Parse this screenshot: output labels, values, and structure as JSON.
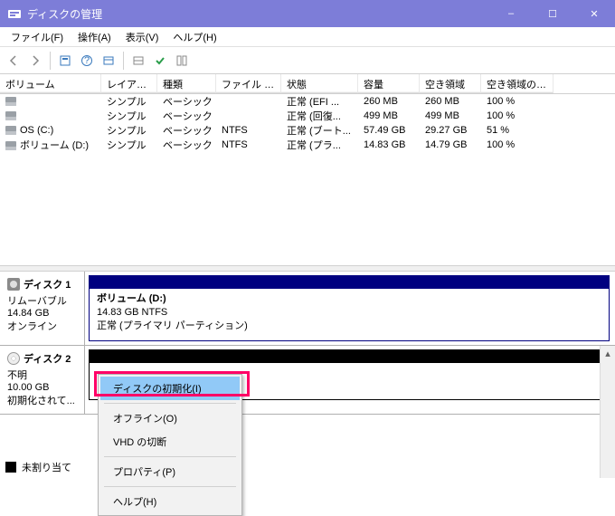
{
  "window": {
    "title": "ディスクの管理",
    "buttons": {
      "min": "–",
      "max": "☐",
      "close": "✕"
    }
  },
  "menubar": [
    "ファイル(F)",
    "操作(A)",
    "表示(V)",
    "ヘルプ(H)"
  ],
  "columns": {
    "volume": "ボリューム",
    "layout": "レイアウト",
    "type": "種類",
    "fs": "ファイル システム",
    "status": "状態",
    "capacity": "容量",
    "free": "空き領域",
    "pct": "空き領域の割..."
  },
  "volumes": [
    {
      "name": "",
      "layout": "シンプル",
      "type": "ベーシック",
      "fs": "",
      "status": "正常 (EFI ...",
      "capacity": "260 MB",
      "free": "260 MB",
      "pct": "100 %"
    },
    {
      "name": "",
      "layout": "シンプル",
      "type": "ベーシック",
      "fs": "",
      "status": "正常 (回復...",
      "capacity": "499 MB",
      "free": "499 MB",
      "pct": "100 %"
    },
    {
      "name": "OS (C:)",
      "layout": "シンプル",
      "type": "ベーシック",
      "fs": "NTFS",
      "status": "正常 (ブート...",
      "capacity": "57.49 GB",
      "free": "29.27 GB",
      "pct": "51 %"
    },
    {
      "name": "ボリューム (D:)",
      "layout": "シンプル",
      "type": "ベーシック",
      "fs": "NTFS",
      "status": "正常 (プラ...",
      "capacity": "14.83 GB",
      "free": "14.79 GB",
      "pct": "100 %"
    }
  ],
  "disks": [
    {
      "label": "ディスク 1",
      "kind": "リムーバブル",
      "size": "14.84 GB",
      "state": "オンライン",
      "vol": {
        "name": "ボリューム  (D:)",
        "detail": "14.83 GB NTFS",
        "status": "正常 (プライマリ パーティション)"
      }
    },
    {
      "label": "ディスク 2",
      "kind": "不明",
      "size": "10.00 GB",
      "state": "初期化されて..."
    }
  ],
  "legend": {
    "label": "未割り当て"
  },
  "context_menu": {
    "init": "ディスクの初期化(I)",
    "offline": "オフライン(O)",
    "vhd": "VHD の切断",
    "props": "プロパティ(P)",
    "help": "ヘルプ(H)"
  }
}
